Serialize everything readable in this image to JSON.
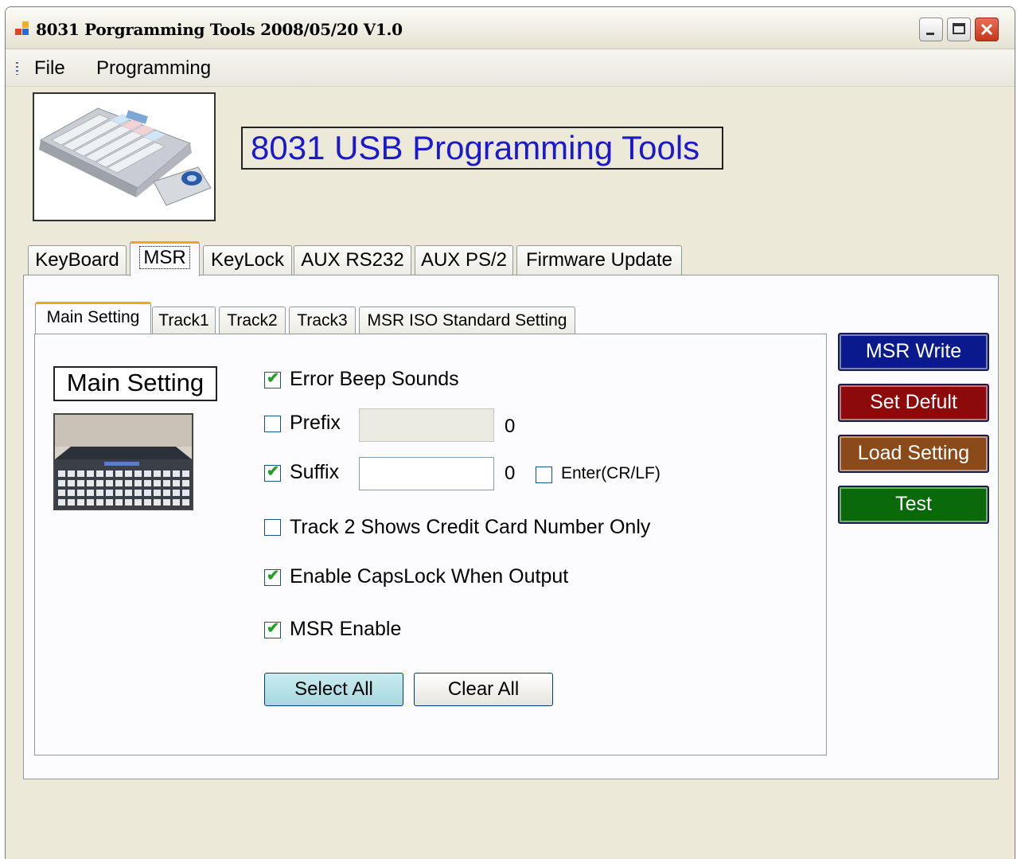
{
  "window": {
    "title": "8031 Porgramming Tools 2008/05/20 V1.0"
  },
  "menu": {
    "file": "File",
    "programming": "Programming"
  },
  "header": {
    "title": "8031 USB Programming Tools"
  },
  "tabs": [
    "KeyBoard",
    "MSR",
    "KeyLock",
    "AUX RS232",
    "AUX PS/2",
    "Firmware Update"
  ],
  "active_tab": "MSR",
  "subtabs": [
    "Main Setting",
    "Track1",
    "Track2",
    "Track3",
    "MSR ISO Standard Setting"
  ],
  "active_subtab": "Main Setting",
  "main_setting": {
    "section_title": "Main Setting",
    "error_beep": {
      "label": "Error Beep Sounds",
      "checked": true
    },
    "prefix": {
      "label": "Prefix",
      "checked": false,
      "value": "",
      "count": "0"
    },
    "suffix": {
      "label": "Suffix",
      "checked": true,
      "value": "",
      "count": "0"
    },
    "enter_crlf": {
      "label": "Enter(CR/LF)",
      "checked": false
    },
    "track2_credit": {
      "label": "Track 2 Shows Credit Card Number Only",
      "checked": false
    },
    "capslock": {
      "label": "Enable CapsLock When Output",
      "checked": true
    },
    "msr_enable": {
      "label": "MSR Enable",
      "checked": true
    },
    "select_all": "Select All",
    "clear_all": "Clear All"
  },
  "side_buttons": {
    "msr_write": "MSR Write",
    "set_default": "Set Defult",
    "load_setting": "Load Setting",
    "test": "Test"
  },
  "colors": {
    "heading_text": "#1a1acc",
    "msr_write_bg": "#0a1a8c",
    "set_default_bg": "#8c0a0a",
    "load_setting_bg": "#8a4a1a",
    "test_bg": "#0a6a0a",
    "tab_highlight": "#f4a21f",
    "check_mark": "#21a121"
  }
}
